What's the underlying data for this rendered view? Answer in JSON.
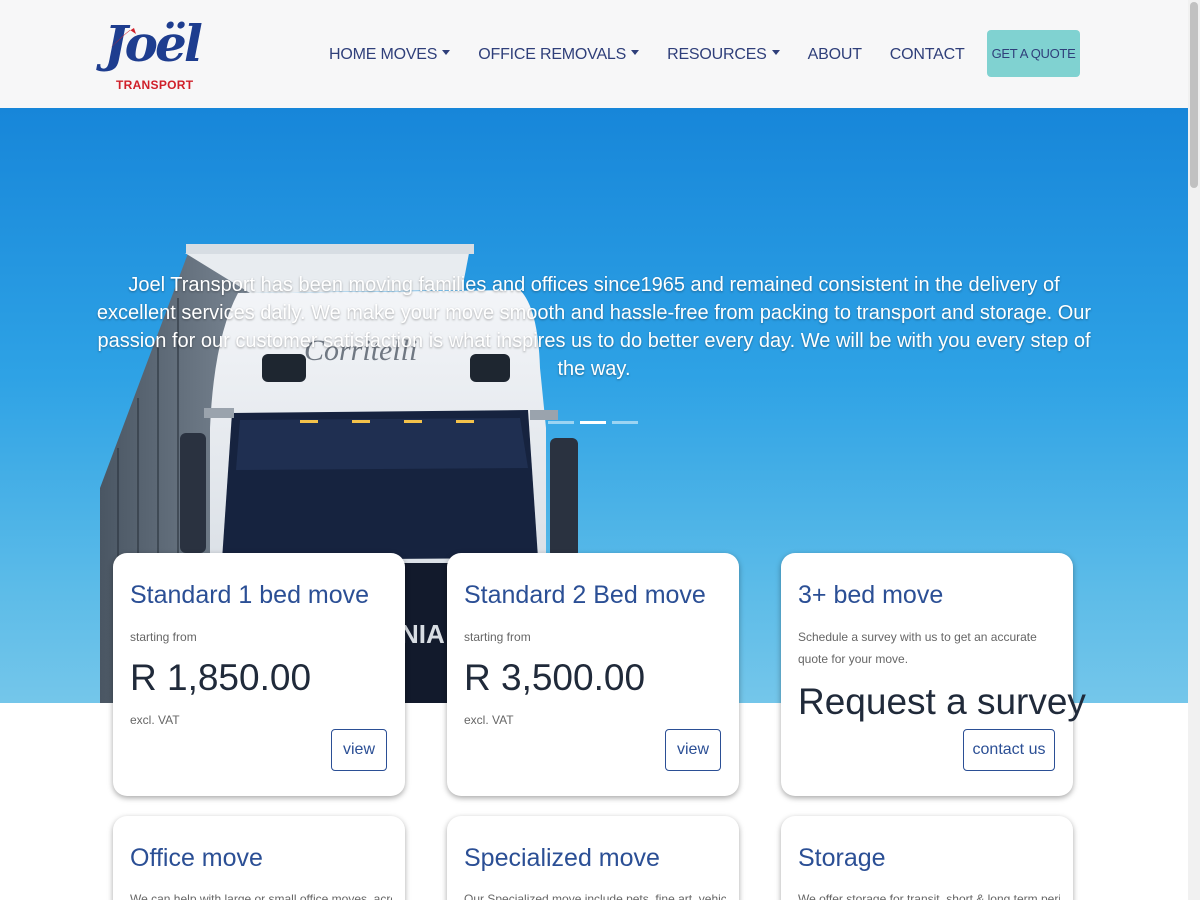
{
  "logo": {
    "word": "Joël",
    "sub": "TRANSPORT"
  },
  "nav": {
    "items": [
      {
        "label": "HOME MOVES",
        "dropdown": true
      },
      {
        "label": "OFFICE REMOVALS",
        "dropdown": true
      },
      {
        "label": "RESOURCES",
        "dropdown": true
      },
      {
        "label": "ABOUT",
        "dropdown": false
      },
      {
        "label": "CONTACT",
        "dropdown": false
      }
    ],
    "quote_button": "GET A QUOTE"
  },
  "hero": {
    "text": "Joel Transport has been moving families and offices since1965 and remained consistent in the delivery of excellent services daily. We make your move smooth and hassle-free from packing to transport and storage. Our passion for our customer satisfaction is what inspires us to do better every day. We will be with you every step of the way.",
    "truck_brand": "Corritelli",
    "truck_grille": "NIA",
    "slides": 3,
    "active_slide": 1
  },
  "cards": [
    {
      "title": "Standard 1 bed move",
      "small": "starting from",
      "price": "R 1,850.00",
      "note": "excl. VAT",
      "button": "view"
    },
    {
      "title": "Standard 2 Bed move",
      "small": "starting from",
      "price": "R 3,500.00",
      "note": "excl. VAT",
      "button": "view"
    },
    {
      "title": "3+ bed move",
      "small": "Schedule a survey with us to get an accurate quote for your move.",
      "headline": "Request a survey",
      "button": "contact us"
    },
    {
      "title": "Office move",
      "small": "We can help with large or small office moves, across"
    },
    {
      "title": "Specialized move",
      "small": "Our Specialized move include pets, fine art, vehicle"
    },
    {
      "title": "Storage",
      "small": "We offer storage for transit, short & long term periods"
    }
  ],
  "colors": {
    "brand_blue": "#2b4f95",
    "brand_red": "#d0202a",
    "accent_teal": "#80d2d1",
    "nav_text": "#2f3f7a"
  }
}
